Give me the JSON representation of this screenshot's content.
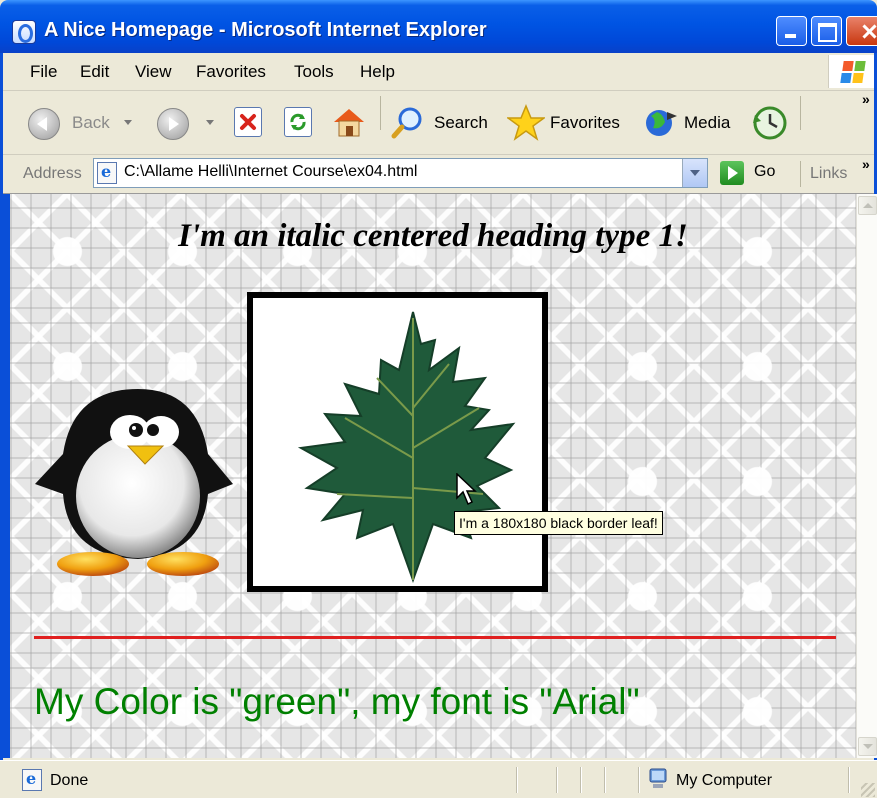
{
  "window": {
    "title": "A Nice Homepage - Microsoft Internet Explorer"
  },
  "menu": {
    "items": [
      "File",
      "Edit",
      "View",
      "Favorites",
      "Tools",
      "Help"
    ]
  },
  "toolbar": {
    "back_label": "Back",
    "search_label": "Search",
    "favorites_label": "Favorites",
    "media_label": "Media",
    "overflow": "»"
  },
  "address_bar": {
    "label": "Address",
    "value": "C:\\Allame Helli\\Internet Course\\ex04.html",
    "go_label": "Go",
    "links_label": "Links",
    "overflow": "»"
  },
  "page": {
    "heading": "I'm an italic centered heading type 1!",
    "tooltip": "I'm a 180x180 black border leaf!",
    "green_text": "My Color is \"green\", my font is \"Arial\"",
    "colors": {
      "heading": "#000000",
      "rule": "#e02020",
      "green_text": "#008000",
      "leaf_border": "#000000"
    }
  },
  "status_bar": {
    "text": "Done",
    "zone": "My Computer"
  },
  "icons": {
    "title": "ie-icon",
    "back": "back-arrow-icon",
    "forward": "forward-arrow-icon",
    "stop": "stop-icon",
    "refresh": "refresh-icon",
    "home": "home-icon",
    "search": "search-icon",
    "favorites": "star-icon",
    "media": "media-icon",
    "history": "history-icon",
    "go": "go-arrow-icon",
    "status": "page-icon",
    "zone": "computer-icon"
  }
}
